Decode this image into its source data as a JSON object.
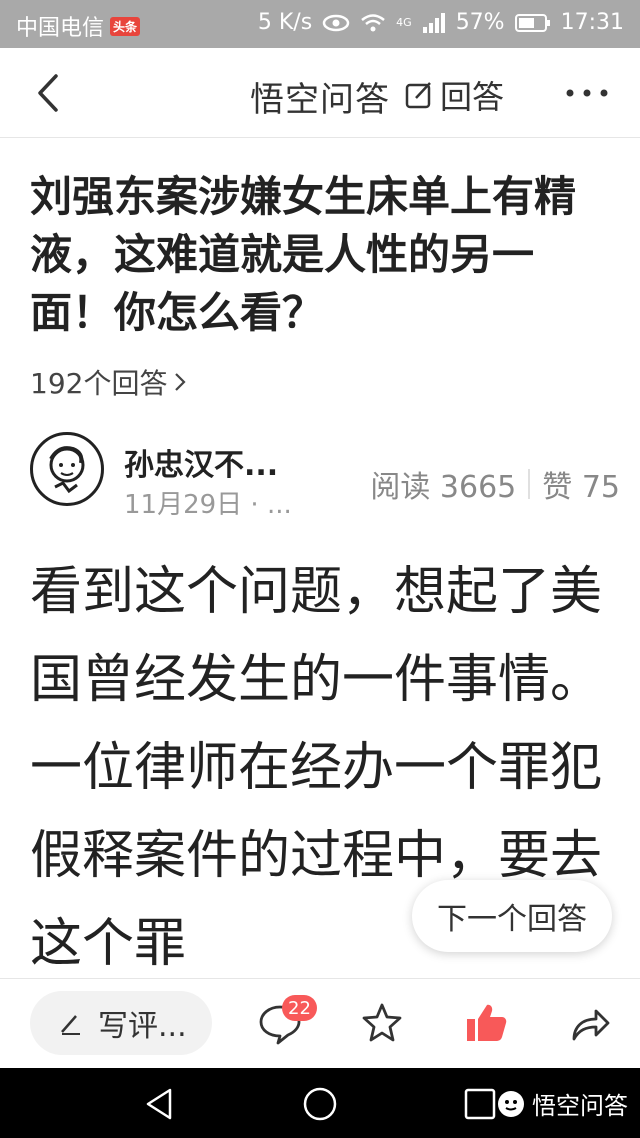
{
  "status_bar": {
    "carrier": "中国电信",
    "carrier_badge": "头条",
    "speed": "5 K/s",
    "network": "4G",
    "battery": "57%",
    "time": "17:31"
  },
  "header": {
    "logo": "悟空问答",
    "answer_label": "回答"
  },
  "question": {
    "title": "刘强东案涉嫌女生床单上有精液，这难道就是人性的另一面！你怎么看？",
    "answer_count": "192个回答"
  },
  "author": {
    "name": "孙忠汉不...",
    "date": "11月29日 · ...",
    "reads": "阅读 3665",
    "likes": "赞 75"
  },
  "answer": {
    "text": "看到这个问题，想起了美国曾经发生的一件事情。一位律师在经办一个罪犯假释案件的过程中，要去这个罪"
  },
  "floating": {
    "next_answer": "下一个回答"
  },
  "action_bar": {
    "comment_placeholder": "写评...",
    "comment_count": "22"
  },
  "nav_bar": {
    "watermark": "悟空问答"
  },
  "colors": {
    "like_red": "#f85959",
    "status_bg": "#a9a9a9"
  }
}
